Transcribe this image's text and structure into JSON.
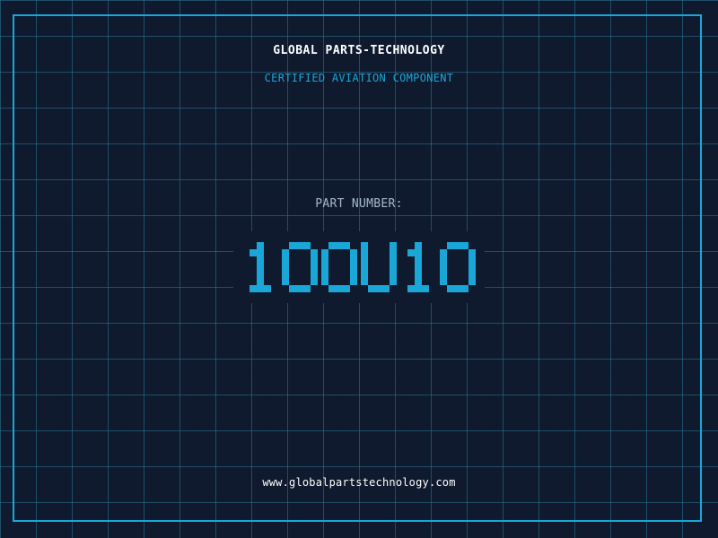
{
  "header": {
    "company_name": "GLOBAL PARTS-TECHNOLOGY",
    "tagline": "CERTIFIED AVIATION COMPONENT"
  },
  "part": {
    "label": "PART NUMBER:",
    "number": "100U10"
  },
  "footer": {
    "website": "www.globalpartstechnology.com"
  },
  "colors": {
    "background": "#0f1a2e",
    "accent": "#1aa6d6",
    "text_primary": "#ffffff",
    "text_muted": "#a9b8cc"
  }
}
